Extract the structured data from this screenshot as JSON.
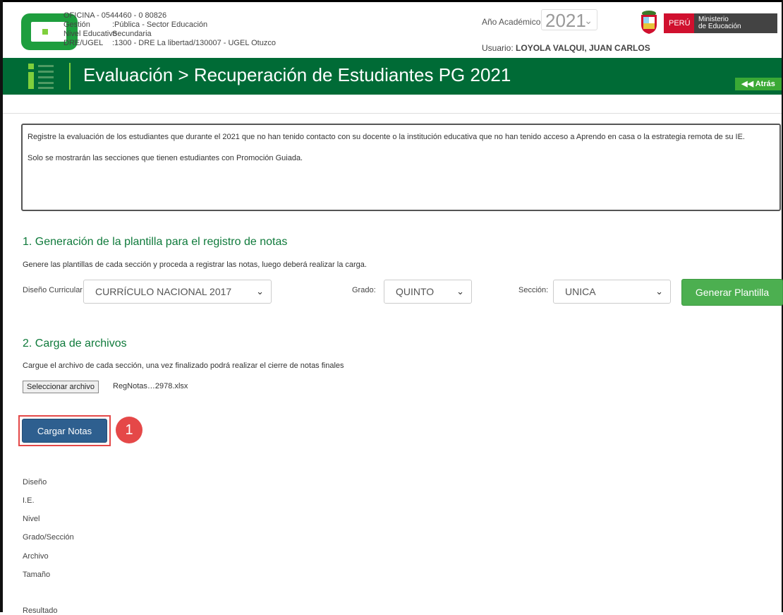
{
  "header": {
    "oficina": "OFICINA - 0544460 - 0  80826",
    "gestion_label": "Gestión",
    "gestion_value": ":Pública - Sector Educación",
    "nivel_label": "Nivel Educativo",
    "nivel_value": "Secundaria",
    "dre_label": "DRE/UGEL",
    "dre_value": ":1300 - DRE La libertad/130007 - UGEL Otuzco",
    "year_label": "Año Académico",
    "year_value": "2021",
    "usuario_label": "Usuario:",
    "usuario_value": "LOYOLA VALQUI, JUAN CARLOS",
    "peru": "PERÚ",
    "ministerio_line1": "Ministerio",
    "ministerio_line2": "de Educación"
  },
  "titlebar": {
    "title": "Evaluación > Recuperación de Estudiantes PG 2021",
    "back_label": "Atrás",
    "back_icon": "double-left-arrow"
  },
  "info": {
    "paragraph1": "Registre la evaluación de los estudiantes que durante el 2021 que no han tenido contacto con su docente o la institución educativa que no han tenido acceso a Aprendo en casa o la estrategia remota de su IE.",
    "paragraph2": "Solo se mostrarán las secciones que tienen estudiantes con Promoción Guiada."
  },
  "section1": {
    "title": "1. Generación de la plantilla para el registro de notas",
    "description": "Genere las plantillas de cada sección y proceda a registrar las notas, luego deberá realizar la carga.",
    "diseno_label": "Diseño Curricular:",
    "diseno_value": "CURRÍCULO NACIONAL 2017",
    "grado_label": "Grado:",
    "grado_value": "QUINTO",
    "seccion_label": "Sección:",
    "seccion_value": "UNICA",
    "generate_button": "Generar Plantilla"
  },
  "section2": {
    "title": "2. Carga de archivos",
    "description": "Cargue el archivo de cada sección, una vez finalizado podrá realizar el cierre de notas finales",
    "file_button": "Seleccionar archivo",
    "file_name": "RegNotas…2978.xlsx",
    "upload_button": "Cargar Notas",
    "callout_number": "1"
  },
  "results": {
    "labels": [
      "Diseño",
      "I.E.",
      "Nivel",
      "Grado/Sección",
      "Archivo",
      "Tamaño",
      "Resultado"
    ]
  },
  "colors": {
    "brand_green": "#006b36",
    "accent_green": "#4caf50",
    "upload_blue": "#2e5f8f",
    "highlight_red": "#e44848"
  }
}
